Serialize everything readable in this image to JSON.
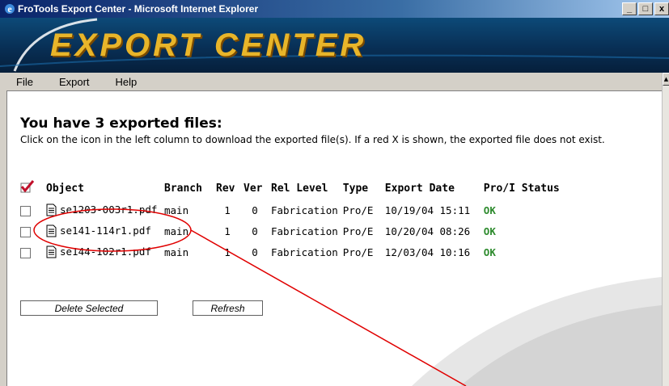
{
  "window": {
    "title": "FroTools Export Center - Microsoft Internet Explorer",
    "controls": [
      "_",
      "□",
      "x"
    ]
  },
  "banner": {
    "text": "EXPORT CENTER"
  },
  "menu": {
    "items": [
      "File",
      "Export",
      "Help"
    ]
  },
  "page": {
    "heading": "You have 3 exported files:",
    "instructions": "Click on the icon in the left column to download the exported file(s). If a red X is shown, the exported file does not exist."
  },
  "table": {
    "headers": {
      "object": "Object",
      "branch": "Branch",
      "rev": "Rev",
      "ver": "Ver",
      "rel_level": "Rel Level",
      "type": "Type",
      "export_date": "Export Date",
      "status": "Pro/I Status"
    },
    "rows": [
      {
        "object": "se1203-003r1.pdf",
        "branch": "main",
        "rev": "1",
        "ver": "0",
        "rel_level": "Fabrication",
        "type": "Pro/E",
        "export_date": "10/19/04 15:11",
        "status": "OK"
      },
      {
        "object": "se141-114r1.pdf",
        "branch": "main",
        "rev": "1",
        "ver": "0",
        "rel_level": "Fabrication",
        "type": "Pro/E",
        "export_date": "10/20/04 08:26",
        "status": "OK"
      },
      {
        "object": "se144-102r1.pdf",
        "branch": "main",
        "rev": "1",
        "ver": "0",
        "rel_level": "Fabrication",
        "type": "Pro/E",
        "export_date": "12/03/04 10:16",
        "status": "OK"
      }
    ]
  },
  "buttons": {
    "delete": "Delete Selected",
    "refresh": "Refresh"
  },
  "colors": {
    "ok_status": "#2e8b2e",
    "annotation": "#e00000",
    "title_bar": "#0a246a",
    "banner_text": "#e8b52a"
  }
}
